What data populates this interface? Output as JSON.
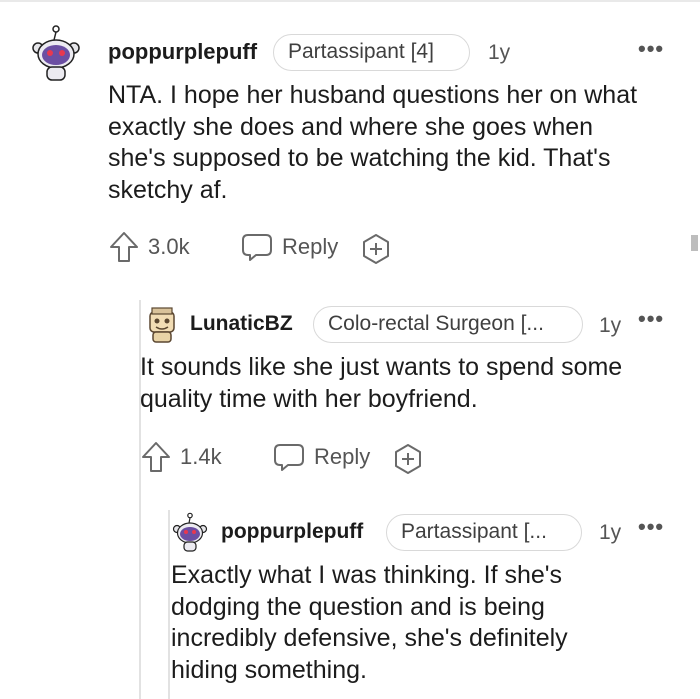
{
  "comments": [
    {
      "author": "poppurplepuff",
      "flair": "Partassipant [4]",
      "age": "1y",
      "more": "•••",
      "body": "NTA. I hope her husband questions her on what exactly she does and where she goes when she's supposed to be watching the kid. That's sketchy af.",
      "votes": "3.0k",
      "reply_label": "Reply"
    },
    {
      "author": "LunaticBZ",
      "flair": "Colo-rectal Surgeon [...",
      "age": "1y",
      "more": "•••",
      "body": "It sounds like she just wants to spend some quality time with her boyfriend.",
      "votes": "1.4k",
      "reply_label": "Reply"
    },
    {
      "author": "poppurplepuff",
      "flair": "Partassipant [...",
      "age": "1y",
      "more": "•••",
      "body": "Exactly what I was thinking. If she's dodging the question and is being incredibly defensive, she's definitely hiding something."
    }
  ],
  "icons": {
    "upvote": "upvote-arrow-icon",
    "reply": "speech-bubble-icon",
    "award": "add-award-icon",
    "more": "more-options-icon"
  },
  "colors": {
    "text": "#1c1c1c",
    "muted": "#555555",
    "border": "#d9d9d9",
    "thread_line": "#e2e2e2"
  }
}
